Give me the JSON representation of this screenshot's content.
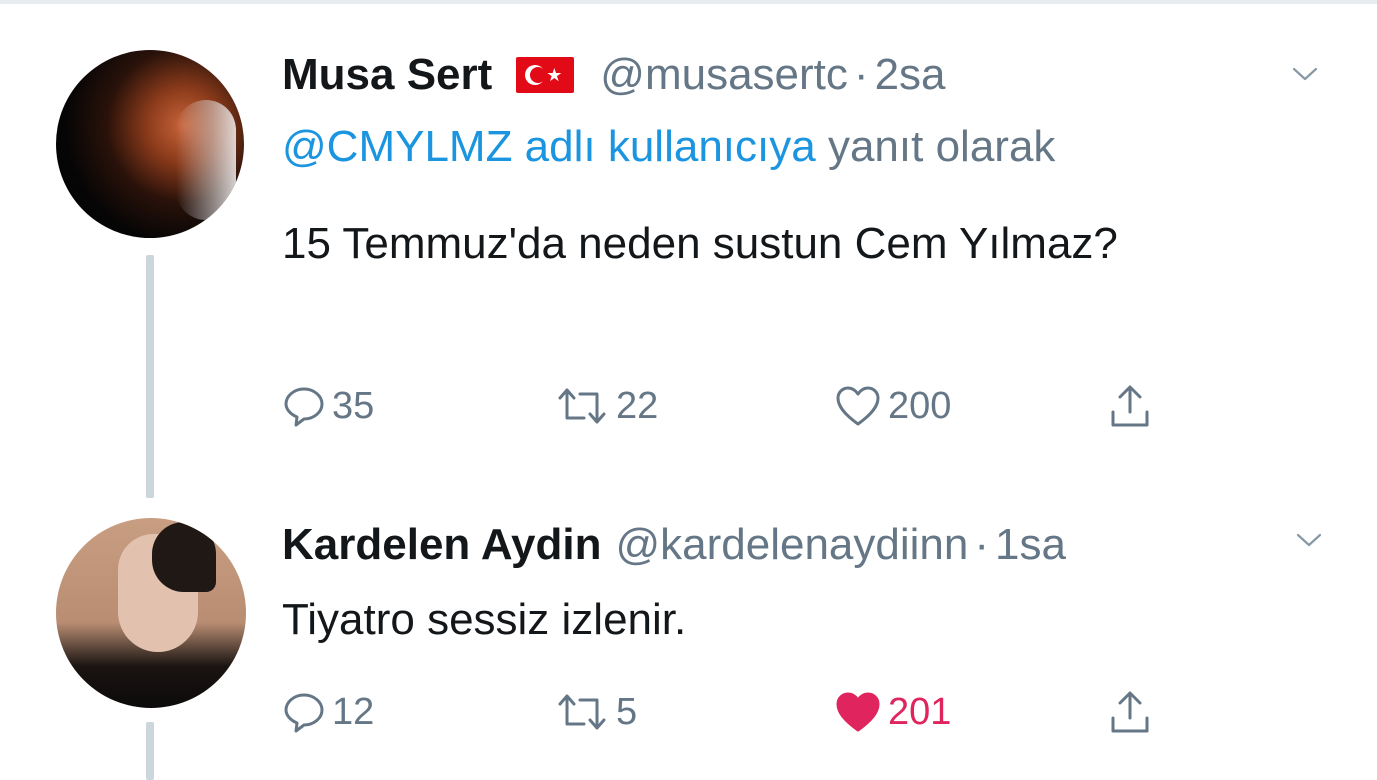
{
  "tweets": [
    {
      "author_name": "Musa Sert",
      "flag": "turkey-flag",
      "handle": "@musasertc",
      "separator": "·",
      "time": "2sa",
      "reply_to_mention": "@CMYLMZ adlı kullanıcıya",
      "reply_to_suffix": "yanıt olarak",
      "text": "15 Temmuz'da neden sustun Cem Yılmaz?",
      "replies": "35",
      "retweets": "22",
      "likes": "200",
      "liked": false
    },
    {
      "author_name": "Kardelen Aydin",
      "handle": "@kardelenaydiinn",
      "separator": "·",
      "time": "1sa",
      "text": "Tiyatro sessiz izlenir.",
      "replies": "12",
      "retweets": "5",
      "likes": "201",
      "liked": true
    }
  ],
  "icons": {
    "reply": "speech-bubble-icon",
    "retweet": "retweet-arrows-icon",
    "like": "heart-icon",
    "share": "share-upload-icon",
    "menu": "chevron-down-icon"
  },
  "colors": {
    "text": "#14171a",
    "secondary": "#657786",
    "link": "#1b95e0",
    "like_active": "#e0245e",
    "thread_line": "#ccd6dd"
  }
}
